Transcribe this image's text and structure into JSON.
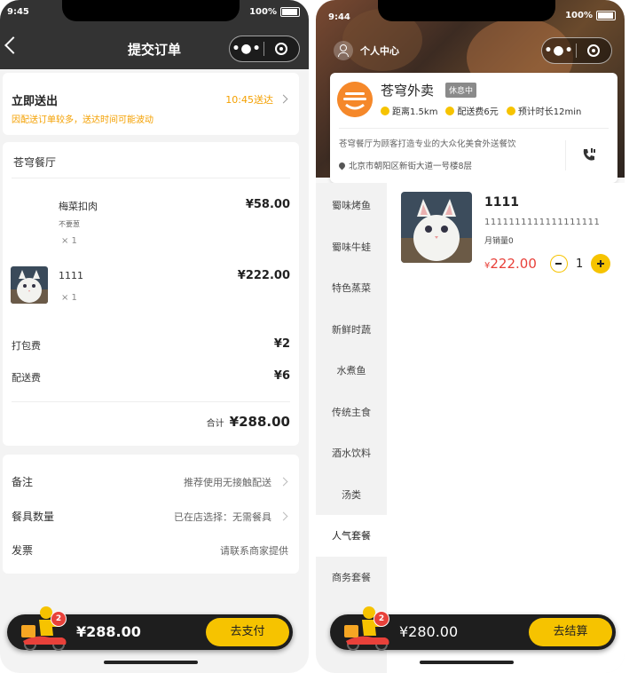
{
  "left": {
    "status": {
      "time": "9:45",
      "battery": "100%"
    },
    "header": {
      "title": "提交订单"
    },
    "delivery": {
      "title": "立即送出",
      "time": "10:45送达",
      "note": "因配送订单较多，送达时间可能波动"
    },
    "order": {
      "restaurant": "苍穹餐厅",
      "items": [
        {
          "name": "梅菜扣肉",
          "spec": "不要葱",
          "qty": "× 1",
          "price": "¥58.00"
        },
        {
          "name": "1111",
          "qty": "× 1",
          "price": "¥222.00"
        }
      ],
      "fees": [
        {
          "label": "打包费",
          "value": "¥2"
        },
        {
          "label": "配送费",
          "value": "¥6"
        }
      ],
      "total_label": "合计",
      "total": "¥288.00"
    },
    "options": [
      {
        "label": "备注",
        "value": "推荐使用无接触配送"
      },
      {
        "label": "餐具数量",
        "value": "已在店选择：无需餐具"
      },
      {
        "label": "发票",
        "value": "请联系商家提供"
      }
    ],
    "bottom": {
      "badge": "2",
      "amount": "¥288.00",
      "button": "去支付"
    }
  },
  "right": {
    "status": {
      "time": "9:44",
      "battery": "100%"
    },
    "user_center": "个人中心",
    "shop": {
      "name": "苍穹外卖",
      "status": "休息中",
      "distance": "距离1.5km",
      "delivery_fee": "配送费6元",
      "eta": "预计时长12min",
      "description": "苍穹餐厅为顾客打造专业的大众化美食外送餐饮",
      "address": "北京市朝阳区新街大道一号楼8层"
    },
    "categories": [
      "蜀味烤鱼",
      "蜀味牛蛙",
      "特色蒸菜",
      "新鲜时蔬",
      "水煮鱼",
      "传统主食",
      "酒水饮料",
      "汤类",
      "人气套餐",
      "商务套餐"
    ],
    "active_category": "人气套餐",
    "dish": {
      "name": "1111",
      "description": "1111111111111111111",
      "sales": "月销量0",
      "price_symbol": "¥",
      "price": "222.00",
      "qty": "1"
    },
    "bottom": {
      "badge": "2",
      "amount": "¥280.00",
      "button": "去结算"
    }
  },
  "colors": {
    "accent": "#f6c300",
    "warning": "#f4a000",
    "price_red": "#e8413a",
    "header_dark": "#333333"
  },
  "icons": [
    "back-icon",
    "more-dots-icon",
    "target-icon",
    "chevron-right-icon",
    "user-icon",
    "location-pin-icon",
    "phone-call-icon",
    "minus-icon",
    "plus-icon",
    "delivery-rider-icon",
    "cat-thumbnail"
  ]
}
